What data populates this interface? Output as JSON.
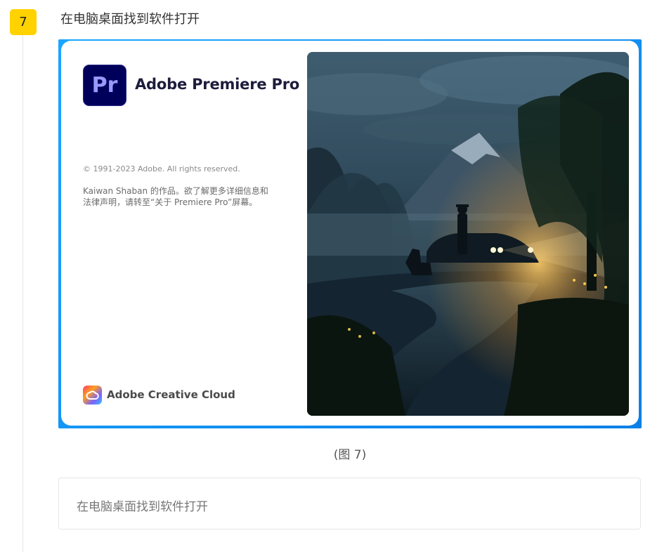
{
  "step": {
    "number": "7",
    "title": "在电脑桌面找到软件打开"
  },
  "splash": {
    "logo_text": "Pr",
    "app_name": "Adobe Premiere Pro",
    "copyright": "© 1991-2023 Adobe. All rights reserved.",
    "credit_line1": "Kaiwan  Shaban 的作品。欲了解更多详细信息和",
    "credit_line2": "法律声明，请转至“关于  Premiere Pro”屏幕。",
    "brand_name": "Adobe Creative Cloud"
  },
  "caption": "(图 7)",
  "note": {
    "text": "在电脑桌面找到软件打开"
  },
  "colors": {
    "badge": "#ffd200",
    "frame_blue": "#1aa6ff",
    "pr_bg": "#00005b",
    "pr_text": "#9999ff"
  }
}
